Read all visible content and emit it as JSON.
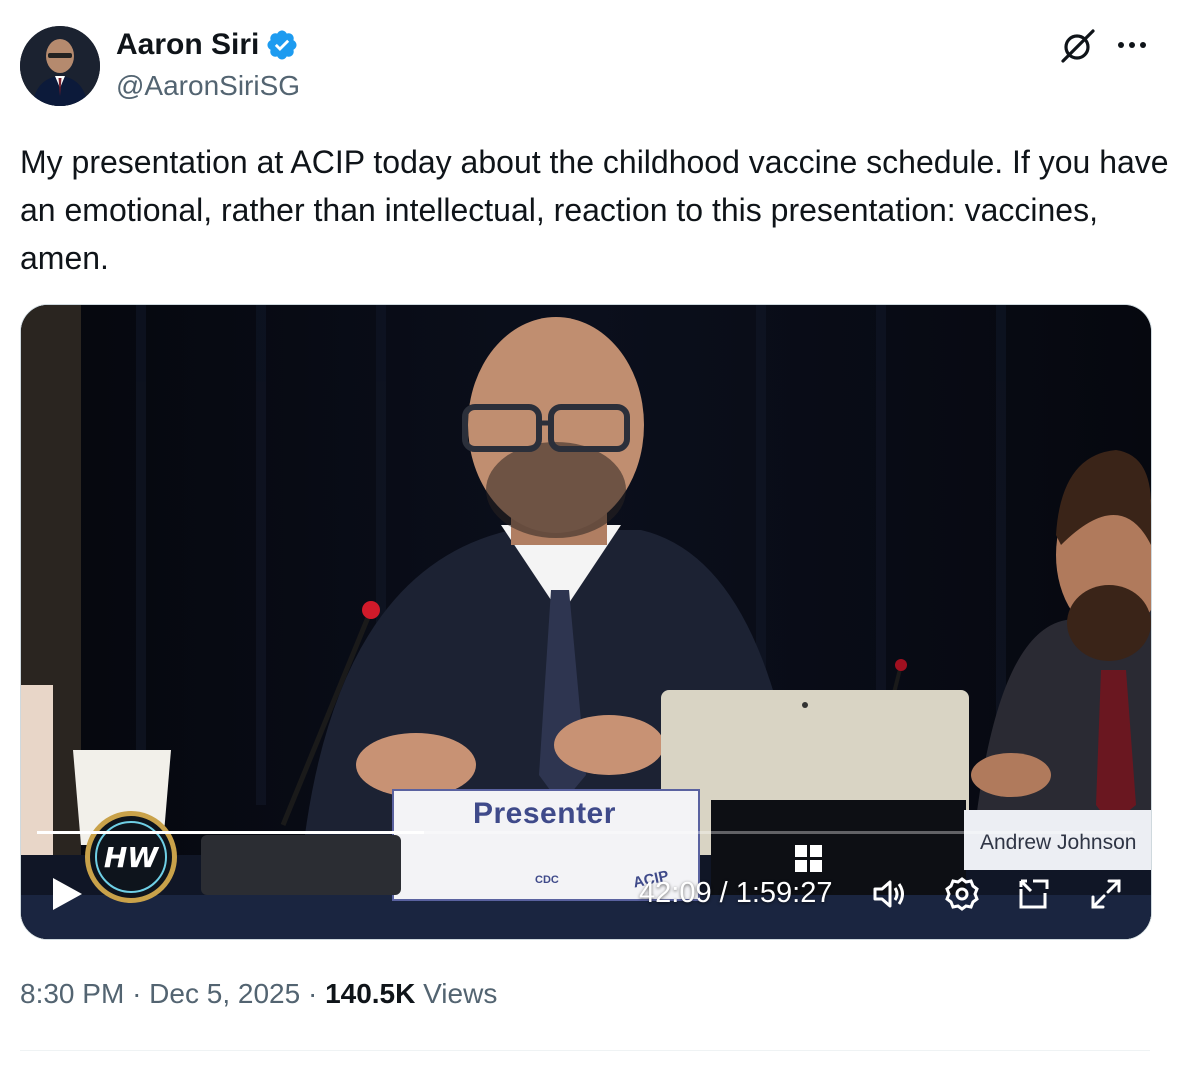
{
  "author": {
    "display_name": "Aaron Siri",
    "handle": "@AaronSiriSG",
    "verified": true
  },
  "icons": {
    "verified": "verified-badge-icon",
    "grok": "grok-icon",
    "more": "more-options-icon"
  },
  "tweet": {
    "text": "My presentation at ACIP today about the childhood vaccine schedule. If you have an emotional, rather than intellectual, reaction to this presentation: vaccines, amen."
  },
  "video": {
    "presenter_sign": "Presenter",
    "cdc_mark": "CDC",
    "acip_mark": "ACIP",
    "nameplate": "Andrew Johnson",
    "logo_text": "HW",
    "current_time": "42:09",
    "duration": "1:59:27",
    "time_display": "42:09 / 1:59:27",
    "progress_fraction": 0.353,
    "controls": [
      "play-icon",
      "volume-icon",
      "settings-icon",
      "pip-icon",
      "fullscreen-icon"
    ]
  },
  "meta": {
    "time": "8:30 PM",
    "separator": "·",
    "date": "Dec 5, 2025",
    "views_count": "140.5K",
    "views_label": "Views"
  },
  "colors": {
    "brand_blue": "#1d9bf0",
    "text_primary": "#0f1419",
    "text_secondary": "#536471"
  }
}
